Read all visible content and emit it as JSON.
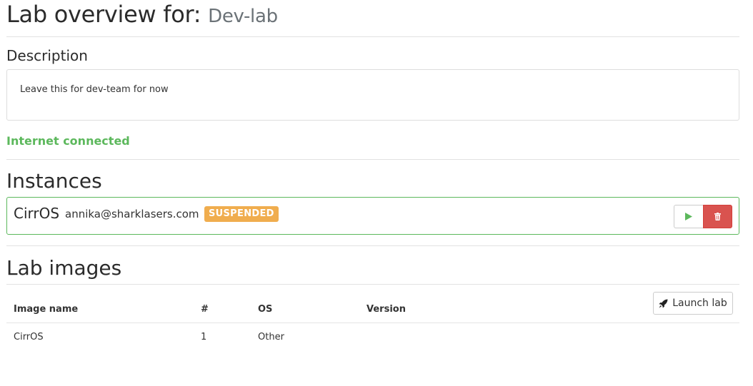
{
  "header": {
    "title_prefix": "Lab overview for:",
    "lab_name": "Dev-lab"
  },
  "description": {
    "heading": "Description",
    "text": "Leave this for dev-team for now"
  },
  "network": {
    "status": "Internet connected",
    "status_color": "#5cb85c"
  },
  "instances": {
    "heading": "Instances",
    "items": [
      {
        "name": "CirrOS",
        "owner": "annika@sharklasers.com",
        "state": "SUSPENDED",
        "state_color": "#f0ad4e",
        "actions": [
          {
            "icon": "play-icon",
            "color": "#5cb85c"
          },
          {
            "icon": "trash-icon",
            "color": "#d9534f"
          }
        ]
      }
    ]
  },
  "lab_images": {
    "heading": "Lab images",
    "launch_label": "Launch lab",
    "launch_icon": "rocket-icon",
    "columns": [
      "Image name",
      "#",
      "OS",
      "Version"
    ],
    "rows": [
      {
        "name": "CirrOS",
        "count": "1",
        "os": "Other",
        "version": ""
      }
    ]
  }
}
